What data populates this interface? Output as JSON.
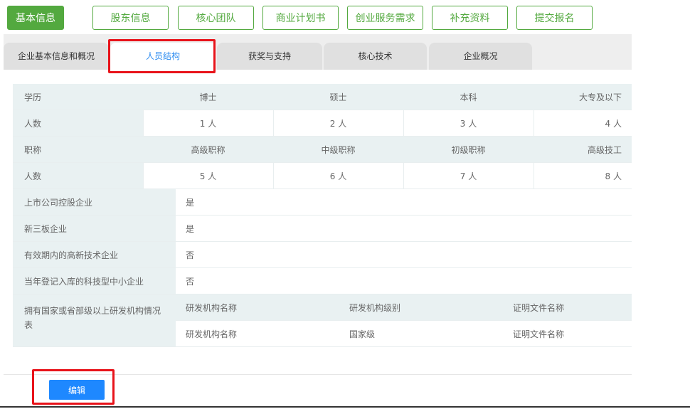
{
  "steps": [
    {
      "label": "基本信息",
      "active": true
    },
    {
      "label": "股东信息",
      "active": false
    },
    {
      "label": "核心团队",
      "active": false
    },
    {
      "label": "商业计划书",
      "active": false
    },
    {
      "label": "创业服务需求",
      "active": false
    },
    {
      "label": "补充资料",
      "active": false
    },
    {
      "label": "提交报名",
      "active": false
    }
  ],
  "tabs": [
    {
      "label": "企业基本信息和概况",
      "active": false
    },
    {
      "label": "人员结构",
      "active": true
    },
    {
      "label": "获奖与支持",
      "active": false
    },
    {
      "label": "核心技术",
      "active": false
    },
    {
      "label": "企业概况",
      "active": false
    }
  ],
  "education": {
    "row_label": "学历",
    "count_label": "人数",
    "headers": [
      "博士",
      "硕士",
      "本科",
      "大专及以下"
    ],
    "values": [
      "1 人",
      "2 人",
      "3 人",
      "4 人"
    ]
  },
  "title": {
    "row_label": "职称",
    "count_label": "人数",
    "headers": [
      "高级职称",
      "中级职称",
      "初级职称",
      "高级技工"
    ],
    "values": [
      "5 人",
      "6 人",
      "7 人",
      "8 人"
    ]
  },
  "flags": [
    {
      "label": "上市公司控股企业",
      "value": "是"
    },
    {
      "label": "新三板企业",
      "value": "是"
    },
    {
      "label": "有效期内的高新技术企业",
      "value": "否"
    },
    {
      "label": "当年登记入库的科技型中小企业",
      "value": "否"
    }
  ],
  "rnd": {
    "label": "拥有国家或省部级以上研发机构情况表",
    "headers": [
      "研发机构名称",
      "研发机构级别",
      "证明文件名称"
    ],
    "row": [
      "研发机构名称",
      "国家级",
      "证明文件名称"
    ]
  },
  "edit_button": "编辑",
  "colors": {
    "green": "#53a93f",
    "blue": "#1e88ff",
    "tab_active_text": "#2d8cf0",
    "highlight": "#e8131a"
  }
}
